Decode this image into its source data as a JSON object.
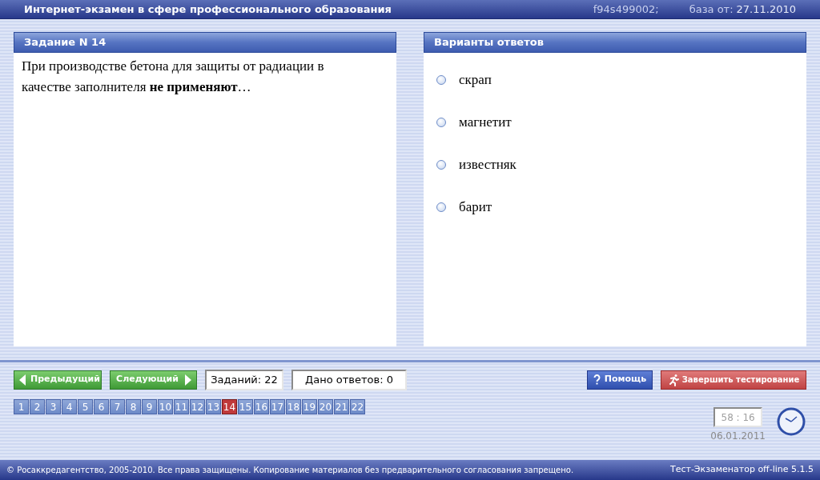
{
  "header": {
    "title": "Интернет-экзамен в сфере профессионального образования",
    "code": "f94s499002;",
    "date_label": "база от:",
    "date": "27.11.2010"
  },
  "task": {
    "title": "Задание N 14",
    "question": "При производстве бетона для защиты от радиации в качестве заполнителя **не применяют**…"
  },
  "answers": {
    "title": "Варианты ответов",
    "options": [
      {
        "label": "скрап",
        "selected": false
      },
      {
        "label": "магнетит",
        "selected": false
      },
      {
        "label": "известняк",
        "selected": false
      },
      {
        "label": "барит",
        "selected": false
      }
    ]
  },
  "nav": {
    "prev": "Предыдущий",
    "next": "Следующий",
    "tasks_count": "Заданий: 22",
    "answered": "Дано ответов: 0",
    "help": "Помощь",
    "finish": "Завершить тестирование"
  },
  "pages": [
    {
      "label": "1",
      "selected": false
    },
    {
      "label": "2",
      "selected": false
    },
    {
      "label": "3",
      "selected": false
    },
    {
      "label": "4",
      "selected": false
    },
    {
      "label": "5",
      "selected": false
    },
    {
      "label": "6",
      "selected": false
    },
    {
      "label": "7",
      "selected": false
    },
    {
      "label": "8",
      "selected": false
    },
    {
      "label": "9",
      "selected": false
    },
    {
      "label": "10",
      "selected": false
    },
    {
      "label": "11",
      "selected": false
    },
    {
      "label": "12",
      "selected": false
    },
    {
      "label": "13",
      "selected": false
    },
    {
      "label": "14",
      "selected": true
    },
    {
      "label": "15",
      "selected": false
    },
    {
      "label": "16",
      "selected": false
    },
    {
      "label": "17",
      "selected": false
    },
    {
      "label": "18",
      "selected": false
    },
    {
      "label": "19",
      "selected": false
    },
    {
      "label": "20",
      "selected": false
    },
    {
      "label": "21",
      "selected": false
    },
    {
      "label": "22",
      "selected": false
    }
  ],
  "timer": {
    "time": "58 : 16",
    "date": "06.01.2011"
  },
  "footer": {
    "copyright": "© Росаккредагентство, 2005-2010. Все права защищены. Копирование материалов без предварительного согласования запрещено.",
    "version": "Тест-Экзаменатор off-line 5.1.5"
  }
}
